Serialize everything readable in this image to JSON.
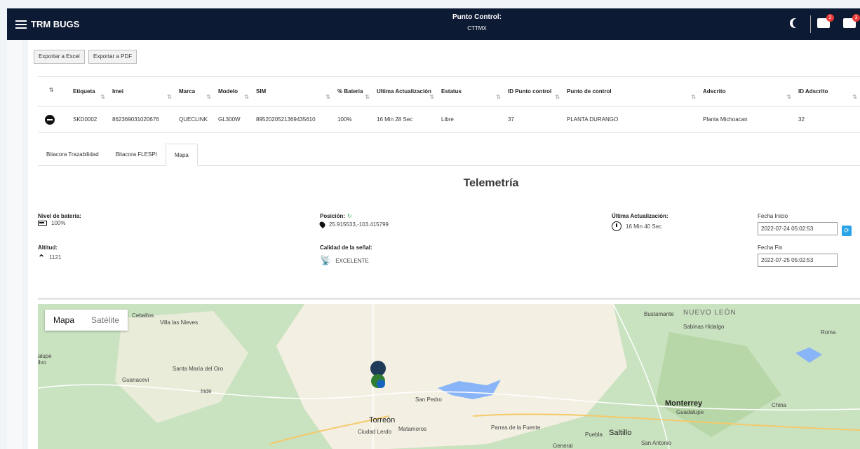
{
  "header": {
    "brand": "TRM BUGS",
    "punto_label": "Punto Control:",
    "punto_value": "CTTMX",
    "badge_truck": "2",
    "badge_plug": "3"
  },
  "buttons": {
    "excel": "Exportar a Excel",
    "pdf": "Exportar a PDF"
  },
  "table": {
    "headers": [
      "Etiqueta",
      "Imei",
      "Marca",
      "Modelo",
      "SIM",
      "% Bateria",
      "Ultima Actualización",
      "Estatus",
      "ID Punto control",
      "Punto de control",
      "Adscrito",
      "ID Adscrito"
    ],
    "row": [
      "SKD0002",
      "862369031020676",
      "QUECLINK",
      "GL300W",
      "8952020521369435610",
      "100%",
      "16 Min 28 Sec",
      "Libre",
      "37",
      "PLANTA DURANGO",
      "Planta Michoacan",
      "32"
    ]
  },
  "tabs": [
    "Bitacora Trazabilidad",
    "Bitacora FLESPI",
    "Mapa"
  ],
  "telemetry": {
    "title": "Telemetría",
    "battery_label": "Nivel de batería:",
    "battery_value": "100%",
    "altitude_label": "Altitud:",
    "altitude_value": "1121",
    "position_label": "Posición:",
    "position_value": "25.915533,-103.415799",
    "signal_label": "Calidad de la señal:",
    "signal_value": "EXCELENTE",
    "last_update_label": "Última Actualización:",
    "last_update_value": "16 Min 40 Sec",
    "start_label": "Fecha Inicio",
    "start_value": "2022-07-24 05:02:53",
    "end_label": "Fecha Fin",
    "end_value": "2022-07-25 05:02:53"
  },
  "map": {
    "type_map": "Mapa",
    "type_sat": "Satélite",
    "labels": [
      "Ceballos",
      "Villa las Nieves",
      "Santa María del Oro",
      "Guanaceví",
      "Indé",
      "Torreón",
      "Ciudad Lerdo",
      "Matamoros",
      "San Pedro",
      "Parras de la Fuente",
      "Puebla",
      "Saltillo",
      "Monterrey",
      "Guadalupe",
      "China",
      "Bustamante",
      "NUEVO LEÓN",
      "Sabinas Hidalgo",
      "Roma",
      "San Antonio",
      "General",
      "alupe ilvo"
    ]
  }
}
